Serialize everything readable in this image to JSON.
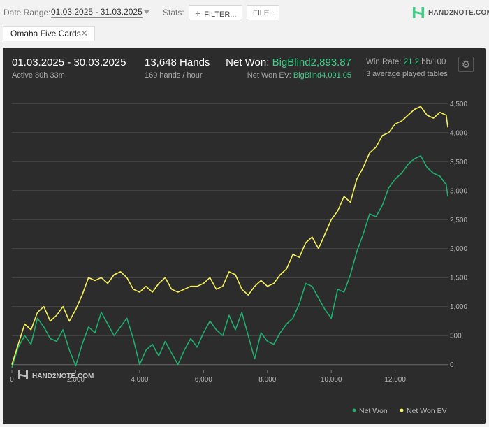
{
  "topbar": {
    "date_range_label": "Date Range:",
    "date_range_value": "01.03.2025 - 31.03.2025",
    "stats_label": "Stats:",
    "filter_button": "FILTER...",
    "file_button": "FILE...",
    "logo_text": "HAND2NOTE.COM"
  },
  "tag": {
    "label": "Omaha Five Cards"
  },
  "header": {
    "period": "01.03.2025 - 30.03.2025",
    "active": "Active 80h 33m",
    "hands": "13,648 Hands",
    "hands_rate": "169 hands / hour",
    "net_won_label": "Net Won: ",
    "net_won_value": "BigBlind2,893.87",
    "net_won_ev_label": "Net Won  EV: ",
    "net_won_ev_value": "BigBlind4,091.05",
    "win_rate_label": "Win Rate: ",
    "win_rate_value": "21.2",
    "win_rate_unit": " bb/100",
    "tables": "3 average played tables"
  },
  "watermark": "HAND2NOTE.COM",
  "colors": {
    "net_won": "#1fae6e",
    "net_won_ev": "#f5f05a",
    "accent": "#3dcf86"
  },
  "chart_data": {
    "type": "line",
    "xlim": [
      0,
      13648
    ],
    "ylim": [
      -100,
      4600
    ],
    "x_ticks": [
      0,
      2000,
      4000,
      6000,
      8000,
      10000,
      12000
    ],
    "x_tick_labels": [
      "0",
      "2,000",
      "4,000",
      "6,000",
      "8,000",
      "10,000",
      "12,000"
    ],
    "y_ticks": [
      0,
      500,
      1000,
      1500,
      2000,
      2500,
      3000,
      3500,
      4000,
      4500
    ],
    "y_tick_labels": [
      "0",
      "500",
      "1,000",
      "1,500",
      "2,000",
      "2,500",
      "3,000",
      "3,500",
      "4,000",
      "4,500"
    ],
    "grid": true,
    "legend_position": "bottom-right",
    "series": [
      {
        "name": "Net Won",
        "x": [
          0,
          200,
          400,
          600,
          800,
          1000,
          1200,
          1400,
          1600,
          1800,
          2000,
          2200,
          2400,
          2600,
          2800,
          3000,
          3200,
          3400,
          3600,
          3800,
          4000,
          4200,
          4400,
          4600,
          4800,
          5000,
          5200,
          5400,
          5600,
          5800,
          6000,
          6200,
          6400,
          6600,
          6800,
          7000,
          7200,
          7400,
          7600,
          7800,
          8000,
          8200,
          8400,
          8600,
          8800,
          9000,
          9200,
          9400,
          9600,
          9800,
          10000,
          10200,
          10400,
          10600,
          10800,
          11000,
          11200,
          11400,
          11600,
          11800,
          12000,
          12200,
          12400,
          12600,
          12800,
          13000,
          13200,
          13400,
          13600,
          13648
        ],
        "y": [
          -50,
          300,
          500,
          350,
          800,
          650,
          450,
          400,
          600,
          250,
          -20,
          350,
          650,
          550,
          900,
          700,
          500,
          650,
          800,
          450,
          0,
          250,
          350,
          150,
          400,
          200,
          0,
          250,
          450,
          300,
          550,
          750,
          600,
          500,
          850,
          600,
          900,
          500,
          100,
          550,
          400,
          350,
          550,
          700,
          800,
          1050,
          1400,
          1350,
          1150,
          950,
          800,
          1300,
          1250,
          1550,
          1950,
          2250,
          2600,
          2550,
          2750,
          3050,
          3200,
          3300,
          3450,
          3550,
          3600,
          3400,
          3300,
          3250,
          3100,
          2900
        ]
      },
      {
        "name": "Net Won  EV",
        "x": [
          0,
          200,
          400,
          600,
          800,
          1000,
          1200,
          1400,
          1600,
          1800,
          2000,
          2200,
          2400,
          2600,
          2800,
          3000,
          3200,
          3400,
          3600,
          3800,
          4000,
          4200,
          4400,
          4600,
          4800,
          5000,
          5200,
          5400,
          5600,
          5800,
          6000,
          6200,
          6400,
          6600,
          6800,
          7000,
          7200,
          7400,
          7600,
          7800,
          8000,
          8200,
          8400,
          8600,
          8800,
          9000,
          9200,
          9400,
          9600,
          9800,
          10000,
          10200,
          10400,
          10600,
          10800,
          11000,
          11200,
          11400,
          11600,
          11800,
          12000,
          12200,
          12400,
          12600,
          12800,
          13000,
          13200,
          13400,
          13600,
          13648
        ],
        "y": [
          0,
          350,
          700,
          600,
          900,
          1000,
          750,
          850,
          1000,
          750,
          950,
          1200,
          1500,
          1450,
          1500,
          1400,
          1550,
          1600,
          1500,
          1300,
          1250,
          1350,
          1250,
          1400,
          1500,
          1300,
          1250,
          1300,
          1350,
          1350,
          1400,
          1500,
          1300,
          1350,
          1600,
          1550,
          1300,
          1200,
          1350,
          1450,
          1350,
          1400,
          1550,
          1650,
          1900,
          1850,
          2100,
          2200,
          2000,
          2250,
          2500,
          2650,
          2900,
          2800,
          3200,
          3400,
          3650,
          3750,
          3950,
          4000,
          4150,
          4200,
          4300,
          4400,
          4450,
          4300,
          4250,
          4350,
          4300,
          4090
        ]
      }
    ]
  }
}
